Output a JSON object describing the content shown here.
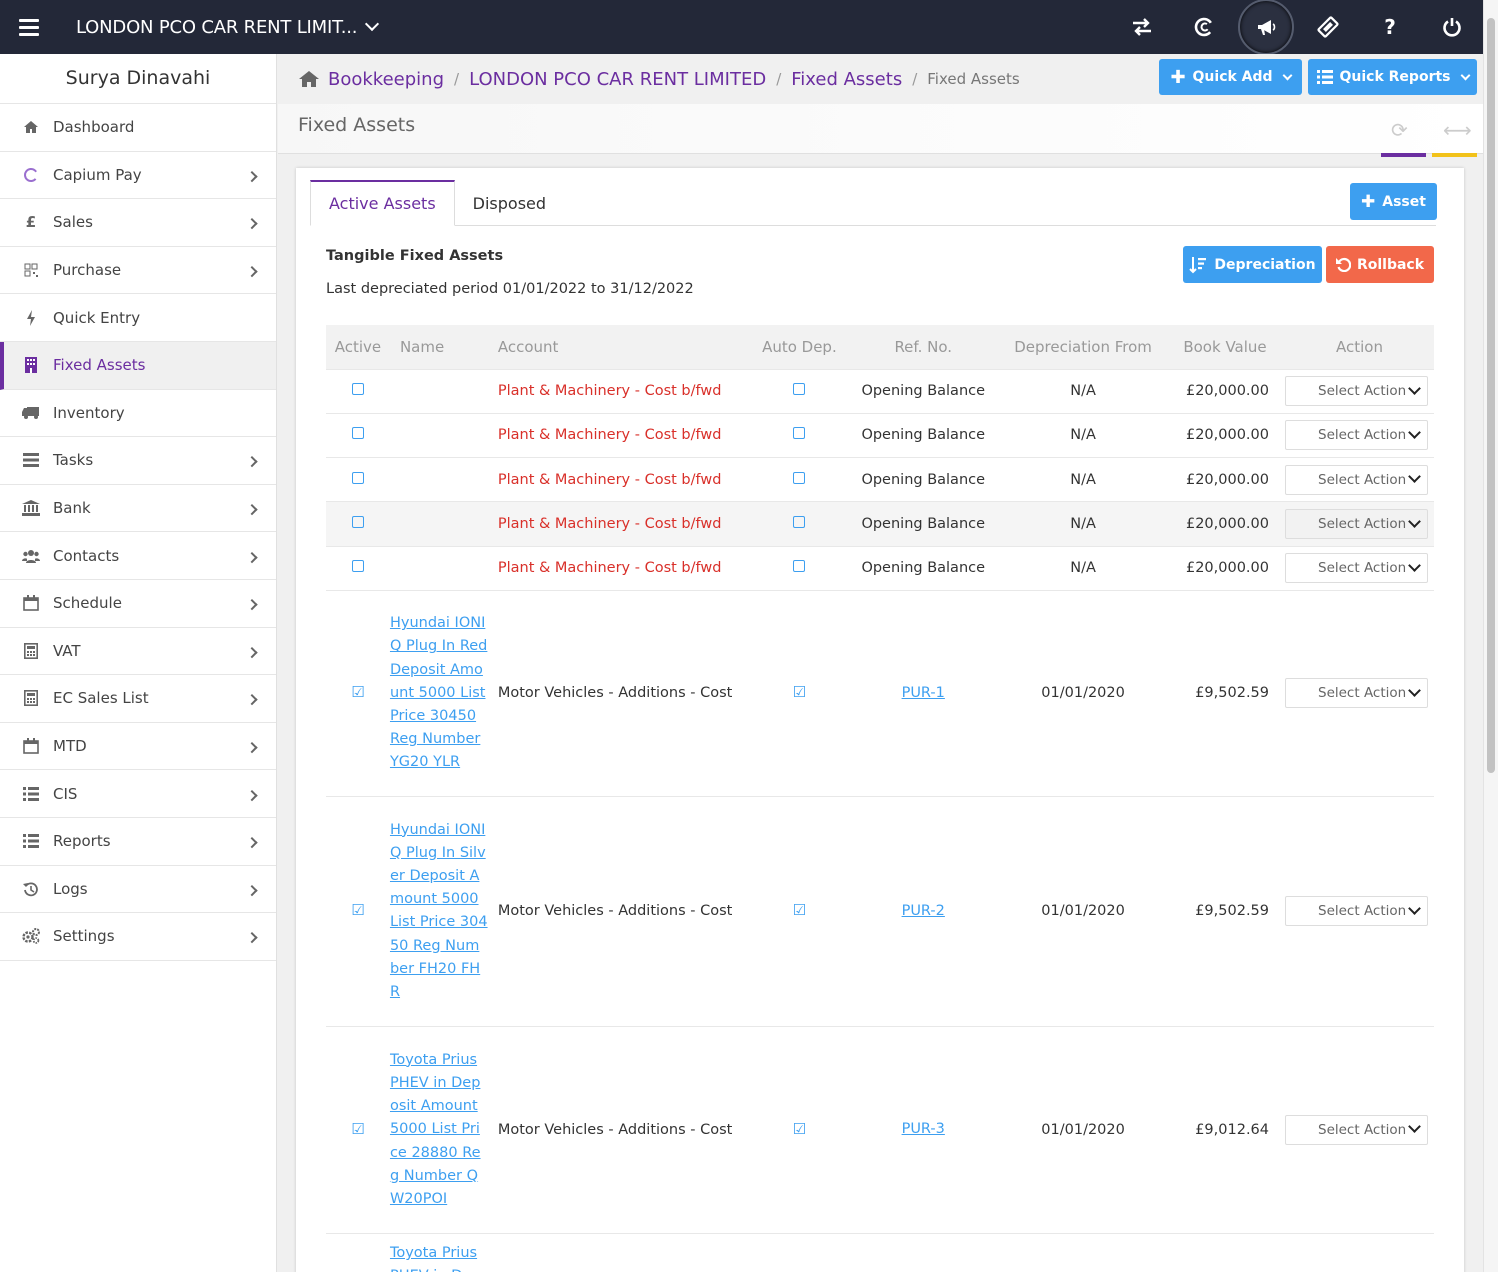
{
  "topbar": {
    "company": "LONDON PCO CAR RENT LIMIT...",
    "icons": [
      "swap-icon",
      "capium-icon",
      "megaphone-icon",
      "ticket-icon",
      "help-icon",
      "power-icon"
    ],
    "help_label": "?"
  },
  "sidebar": {
    "user": "Surya Dinavahi",
    "items": [
      {
        "label": "Dashboard",
        "icon": "home-icon"
      },
      {
        "label": "Capium Pay",
        "icon": "capium-icon"
      },
      {
        "label": "Sales",
        "icon": "pound-icon"
      },
      {
        "label": "Purchase",
        "icon": "qr-icon"
      },
      {
        "label": "Quick Entry",
        "icon": "bolt-icon"
      },
      {
        "label": "Fixed Assets",
        "icon": "building-icon"
      },
      {
        "label": "Inventory",
        "icon": "truck-icon"
      },
      {
        "label": "Tasks",
        "icon": "tasks-icon"
      },
      {
        "label": "Bank",
        "icon": "bank-icon"
      },
      {
        "label": "Contacts",
        "icon": "users-icon"
      },
      {
        "label": "Schedule",
        "icon": "calendar-icon"
      },
      {
        "label": "VAT",
        "icon": "calculator-icon"
      },
      {
        "label": "EC Sales List",
        "icon": "calculator-icon"
      },
      {
        "label": "MTD",
        "icon": "calendar-icon"
      },
      {
        "label": "CIS",
        "icon": "list-icon"
      },
      {
        "label": "Reports",
        "icon": "list-icon"
      },
      {
        "label": "Logs",
        "icon": "history-icon"
      },
      {
        "label": "Settings",
        "icon": "gears-icon"
      }
    ]
  },
  "breadcrumb": [
    "Bookkeeping",
    "LONDON PCO CAR RENT LIMITED",
    "Fixed Assets",
    "Fixed Assets"
  ],
  "header_buttons": {
    "quick_add": "Quick Add",
    "quick_reports": "Quick Reports"
  },
  "page_title": "Fixed Assets",
  "tabs": [
    "Active Assets",
    "Disposed"
  ],
  "add_asset": "Asset",
  "section": {
    "title": "Tangible Fixed Assets",
    "subtitle": "Last depreciated period 01/01/2022 to 31/12/2022",
    "depreciation": "Depreciation",
    "rollback": "Rollback"
  },
  "table": {
    "headers": [
      "Active",
      "Name",
      "Account",
      "Auto Dep.",
      "Ref. No.",
      "Depreciation From",
      "Book Value",
      "Action"
    ],
    "rows": [
      {
        "name": "",
        "account": "Plant & Machinery - Cost b/fwd",
        "ref": "Opening Balance",
        "from": "N/A",
        "book": "£20,000.00",
        "action": "Select Action"
      },
      {
        "name": "",
        "account": "Plant & Machinery - Cost b/fwd",
        "ref": "Opening Balance",
        "from": "N/A",
        "book": "£20,000.00",
        "action": "Select Action"
      },
      {
        "name": "",
        "account": "Plant & Machinery - Cost b/fwd",
        "ref": "Opening Balance",
        "from": "N/A",
        "book": "£20,000.00",
        "action": "Select Action"
      },
      {
        "name": "",
        "account": "Plant & Machinery - Cost b/fwd",
        "ref": "Opening Balance",
        "from": "N/A",
        "book": "£20,000.00",
        "action": "Select Action"
      },
      {
        "name": "",
        "account": "Plant & Machinery - Cost b/fwd",
        "ref": "Opening Balance",
        "from": "N/A",
        "book": "£20,000.00",
        "action": "Select Action"
      },
      {
        "name": "Hyundai IONIQ Plug In Red Deposit Amount 5000 List Price 30450 Reg Number YG20 YLR",
        "account": "Motor Vehicles - Additions - Cost",
        "ref": "PUR-1",
        "from": "01/01/2020",
        "book": "£9,502.59",
        "action": "Select Action"
      },
      {
        "name": "Hyundai IONIQ Plug In Silver Deposit Amount 5000 List Price 30450 Reg Number FH20 FHR",
        "account": "Motor Vehicles - Additions - Cost",
        "ref": "PUR-2",
        "from": "01/01/2020",
        "book": "£9,502.59",
        "action": "Select Action"
      },
      {
        "name": "Toyota Prius PHEV in Deposit Amount 5000 List Price 28880 Reg Number QW20POI",
        "account": "Motor Vehicles - Additions - Cost",
        "ref": "PUR-3",
        "from": "01/01/2020",
        "book": "£9,012.64",
        "action": "Select Action"
      },
      {
        "name": "Toyota Prius PHEV in D",
        "account": "",
        "ref": "",
        "from": "",
        "book": "",
        "action": ""
      }
    ]
  }
}
